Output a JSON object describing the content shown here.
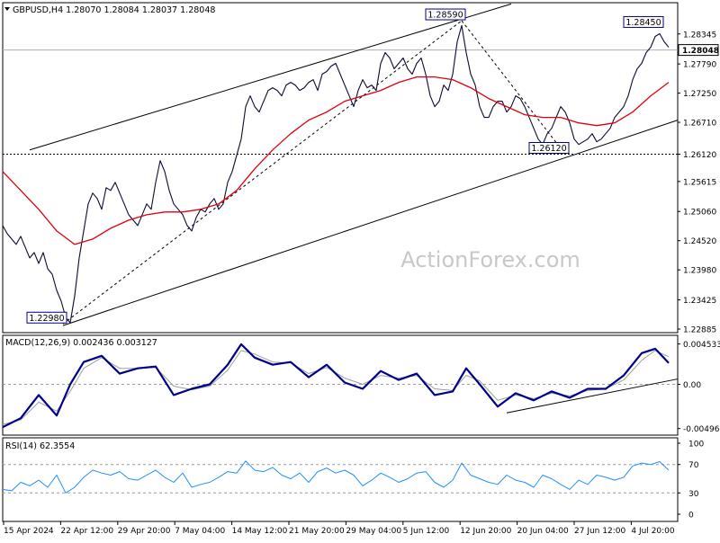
{
  "chart_data": [
    {
      "panel": "price",
      "type": "line",
      "symbol": "GBPUSD",
      "timeframe": "H4",
      "title": "GBPUSD,H4",
      "ohlc": {
        "open": "1.28070",
        "high": "1.28084",
        "low": "1.28037",
        "close": "1.28048"
      },
      "last_price": "1.28048",
      "watermark": "ActionForex.com",
      "ylim": [
        1.22885,
        1.2884
      ],
      "y_ticks": [
        "1.28345",
        "1.27790",
        "1.27250",
        "1.26710",
        "1.26120",
        "1.25615",
        "1.25060",
        "1.24520",
        "1.23980",
        "1.23425",
        "1.22885"
      ],
      "x_ticks": [
        "15 Apr 2024",
        "22 Apr 12:00",
        "29 Apr 20:00",
        "7 May 04:00",
        "14 May 12:00",
        "21 May 20:00",
        "29 May 04:00",
        "5 Jun 12:00",
        "12 Jun 20:00",
        "20 Jun 04:00",
        "27 Jun 12:00",
        "4 Jul 20:00"
      ],
      "series": [
        {
          "kind": "price",
          "x": [
            0,
            5,
            10,
            15,
            20,
            25,
            30,
            35,
            40,
            45,
            50,
            55,
            60,
            65,
            70,
            75,
            80,
            85,
            90,
            95,
            100,
            105,
            110,
            115,
            120,
            125,
            130,
            135,
            140,
            145,
            150,
            155,
            160,
            165,
            170,
            175,
            180,
            185,
            190,
            195,
            200,
            205,
            210,
            215,
            220,
            225,
            230,
            235,
            240,
            245,
            250,
            255,
            260,
            265,
            270,
            275,
            280,
            285,
            290,
            295,
            300,
            305,
            310,
            315,
            320,
            325,
            330,
            335,
            340,
            345,
            350,
            355,
            360,
            365,
            370,
            375,
            380,
            385,
            390,
            395,
            400,
            405,
            410,
            415,
            420,
            425,
            430,
            435,
            440,
            445,
            450,
            455,
            460,
            465,
            470,
            475,
            480,
            485,
            490,
            495,
            500,
            505,
            510,
            515,
            520,
            525,
            530,
            535,
            540,
            545,
            550,
            555,
            560,
            565,
            570,
            575,
            580,
            585,
            590,
            595,
            600,
            605,
            610,
            615,
            620,
            625,
            630,
            635,
            640,
            645,
            650,
            655,
            660,
            665,
            670,
            675,
            680,
            685,
            690,
            695,
            700,
            705,
            710,
            715,
            720,
            725,
            730,
            735,
            740
          ],
          "values": [
            1.248,
            1.2465,
            1.2455,
            1.2445,
            1.246,
            1.244,
            1.242,
            1.243,
            1.241,
            1.243,
            1.24,
            1.239,
            1.236,
            1.234,
            1.231,
            1.23,
            1.235,
            1.242,
            1.247,
            1.252,
            1.254,
            1.253,
            1.251,
            1.255,
            1.2545,
            1.256,
            1.254,
            1.252,
            1.25,
            1.249,
            1.248,
            1.25,
            1.252,
            1.251,
            1.256,
            1.26,
            1.258,
            1.2545,
            1.252,
            1.251,
            1.25,
            1.248,
            1.247,
            1.2495,
            1.251,
            1.2505,
            1.252,
            1.253,
            1.251,
            1.252,
            1.256,
            1.258,
            1.261,
            1.264,
            1.27,
            1.272,
            1.27,
            1.269,
            1.271,
            1.273,
            1.2735,
            1.273,
            1.272,
            1.274,
            1.2745,
            1.274,
            1.273,
            1.2735,
            1.2745,
            1.275,
            1.273,
            1.276,
            1.2765,
            1.2775,
            1.278,
            1.276,
            1.274,
            1.272,
            1.27,
            1.273,
            1.275,
            1.2735,
            1.274,
            1.273,
            1.278,
            1.28,
            1.279,
            1.277,
            1.278,
            1.279,
            1.277,
            1.276,
            1.278,
            1.279,
            1.276,
            1.272,
            1.27,
            1.271,
            1.274,
            1.273,
            1.276,
            1.282,
            1.285,
            1.28,
            1.276,
            1.274,
            1.27,
            1.268,
            1.268,
            1.27,
            1.271,
            1.271,
            1.269,
            1.27,
            1.272,
            1.2715,
            1.27,
            1.268,
            1.266,
            1.264,
            1.263,
            1.265,
            1.266,
            1.268,
            1.27,
            1.269,
            1.267,
            1.264,
            1.263,
            1.2635,
            1.264,
            1.265,
            1.2635,
            1.264,
            1.265,
            1.266,
            1.268,
            1.269,
            1.27,
            1.272,
            1.275,
            1.277,
            1.278,
            1.28,
            1.281,
            1.283,
            1.2835,
            1.282,
            1.281
          ]
        },
        {
          "kind": "moving-average",
          "x": [
            0,
            20,
            40,
            60,
            80,
            100,
            120,
            140,
            160,
            180,
            200,
            220,
            240,
            260,
            280,
            300,
            320,
            340,
            360,
            380,
            400,
            420,
            440,
            460,
            480,
            500,
            520,
            540,
            560,
            580,
            600,
            620,
            640,
            660,
            680,
            700,
            720,
            740
          ],
          "values": [
            1.258,
            1.2545,
            1.251,
            1.247,
            1.2445,
            1.2455,
            1.2475,
            1.249,
            1.25,
            1.2505,
            1.2505,
            1.251,
            1.252,
            1.2545,
            1.2585,
            1.262,
            1.265,
            1.2675,
            1.269,
            1.271,
            1.272,
            1.273,
            1.2745,
            1.2755,
            1.2755,
            1.275,
            1.2735,
            1.2715,
            1.27,
            1.2685,
            1.268,
            1.268,
            1.267,
            1.2665,
            1.267,
            1.269,
            1.272,
            1.2745
          ]
        }
      ],
      "annotations": [
        {
          "label": "1.28590",
          "x": 510,
          "value": 1.2859
        },
        {
          "label": "1.28450",
          "x": 730,
          "value": 1.2845
        },
        {
          "label": "1.26120",
          "x": 625,
          "value": 1.2612
        },
        {
          "label": "1.22980",
          "x": 67,
          "value": 1.2298
        }
      ],
      "trendlines": [
        {
          "style": "solid",
          "from": {
            "x": 30,
            "value": 1.262
          },
          "to": {
            "x": 565,
            "value": 1.289
          }
        },
        {
          "style": "solid",
          "from": {
            "x": 67,
            "value": 1.2295
          },
          "to": {
            "x": 750,
            "value": 1.2675
          }
        },
        {
          "style": "dashed",
          "from": {
            "x": 67,
            "value": 1.2298
          },
          "to": {
            "x": 510,
            "value": 1.2859
          }
        },
        {
          "style": "dashed",
          "from": {
            "x": 510,
            "value": 1.2859
          },
          "to": {
            "x": 625,
            "value": 1.2612
          }
        }
      ],
      "reference_lines": [
        {
          "style": "dotted",
          "value": 1.2612
        },
        {
          "style": "solid-light",
          "value": 1.28048
        }
      ],
      "colors": {
        "price": "#0b0b30",
        "moving_average": "#e0000d",
        "frame": "#000000"
      }
    },
    {
      "panel": "macd",
      "type": "line",
      "title": "MACD(12,26,9) 0.002436 0.003127",
      "ylim": [
        -0.0055,
        0.0052
      ],
      "y_ticks": [
        "0.004533",
        "0.00",
        "-0.00496"
      ],
      "series": [
        {
          "kind": "macd",
          "x": [
            0,
            20,
            40,
            60,
            75,
            90,
            110,
            130,
            150,
            170,
            190,
            210,
            230,
            250,
            265,
            280,
            300,
            320,
            340,
            360,
            380,
            400,
            420,
            440,
            460,
            480,
            500,
            515,
            530,
            550,
            570,
            590,
            610,
            630,
            650,
            670,
            690,
            710,
            725,
            740
          ],
          "values": [
            -0.0048,
            -0.0038,
            -0.0012,
            -0.0035,
            0.0,
            0.0025,
            0.0032,
            0.0012,
            0.0018,
            0.002,
            -0.0012,
            -0.0005,
            0.0,
            0.0022,
            0.0045,
            0.003,
            0.0022,
            0.0025,
            0.0008,
            0.0022,
            0.0002,
            -0.0005,
            0.0015,
            0.0005,
            0.0012,
            -0.0012,
            -0.0008,
            0.0018,
            0.0,
            -0.0025,
            -0.001,
            -0.0018,
            -0.0008,
            -0.0015,
            -0.0005,
            -0.0005,
            0.001,
            0.0035,
            0.004,
            0.0024
          ]
        },
        {
          "kind": "signal",
          "x": [
            0,
            20,
            40,
            60,
            75,
            90,
            110,
            130,
            150,
            170,
            190,
            210,
            230,
            250,
            265,
            280,
            300,
            320,
            340,
            360,
            380,
            400,
            420,
            440,
            460,
            480,
            500,
            515,
            530,
            550,
            570,
            590,
            610,
            630,
            650,
            670,
            690,
            710,
            725,
            740
          ],
          "values": [
            -0.0045,
            -0.004,
            -0.002,
            -0.003,
            -0.0008,
            0.0018,
            0.003,
            0.0018,
            0.0018,
            0.0019,
            -0.0002,
            -0.0006,
            -0.0002,
            0.0016,
            0.0038,
            0.0034,
            0.0025,
            0.0024,
            0.0012,
            0.0019,
            0.0007,
            0.0,
            0.001,
            0.0007,
            0.001,
            -0.0005,
            -0.0007,
            0.001,
            0.0004,
            -0.0018,
            -0.0012,
            -0.0016,
            -0.001,
            -0.0013,
            -0.0007,
            -0.0005,
            0.0005,
            0.0027,
            0.0038,
            0.0031
          ]
        }
      ],
      "trendlines": [
        {
          "style": "solid",
          "from": {
            "x": 560,
            "value": -0.0032
          },
          "to": {
            "x": 750,
            "value": 0.0006
          }
        }
      ],
      "colors": {
        "macd": "#00008b",
        "signal": "#9e9e9e"
      }
    },
    {
      "panel": "rsi",
      "type": "line",
      "title": "RSI(14) 62.3554",
      "ylim": [
        0,
        100
      ],
      "y_ticks": [
        "100",
        "70",
        "30",
        "0"
      ],
      "series": [
        {
          "kind": "rsi",
          "x": [
            0,
            10,
            20,
            30,
            40,
            50,
            60,
            70,
            80,
            90,
            100,
            110,
            120,
            130,
            140,
            150,
            160,
            170,
            180,
            190,
            200,
            210,
            220,
            230,
            240,
            250,
            260,
            270,
            280,
            290,
            300,
            310,
            320,
            330,
            340,
            350,
            360,
            370,
            380,
            390,
            400,
            410,
            420,
            430,
            440,
            450,
            460,
            470,
            480,
            490,
            500,
            510,
            520,
            530,
            540,
            550,
            560,
            570,
            580,
            590,
            600,
            610,
            620,
            630,
            640,
            650,
            660,
            670,
            680,
            690,
            700,
            710,
            720,
            730,
            740
          ],
          "values": [
            35,
            33,
            45,
            40,
            48,
            38,
            55,
            30,
            38,
            52,
            62,
            58,
            55,
            60,
            50,
            48,
            55,
            62,
            52,
            45,
            58,
            38,
            42,
            45,
            52,
            60,
            58,
            75,
            62,
            60,
            66,
            55,
            50,
            58,
            45,
            60,
            65,
            58,
            62,
            55,
            40,
            48,
            58,
            52,
            45,
            50,
            58,
            60,
            45,
            38,
            48,
            72,
            55,
            50,
            45,
            42,
            55,
            48,
            45,
            38,
            55,
            50,
            42,
            35,
            48,
            42,
            55,
            52,
            48,
            52,
            68,
            72,
            70,
            74,
            62
          ]
        }
      ],
      "reference_levels": [
        70,
        30
      ],
      "colors": {
        "rsi": "#1e90ff"
      }
    }
  ]
}
